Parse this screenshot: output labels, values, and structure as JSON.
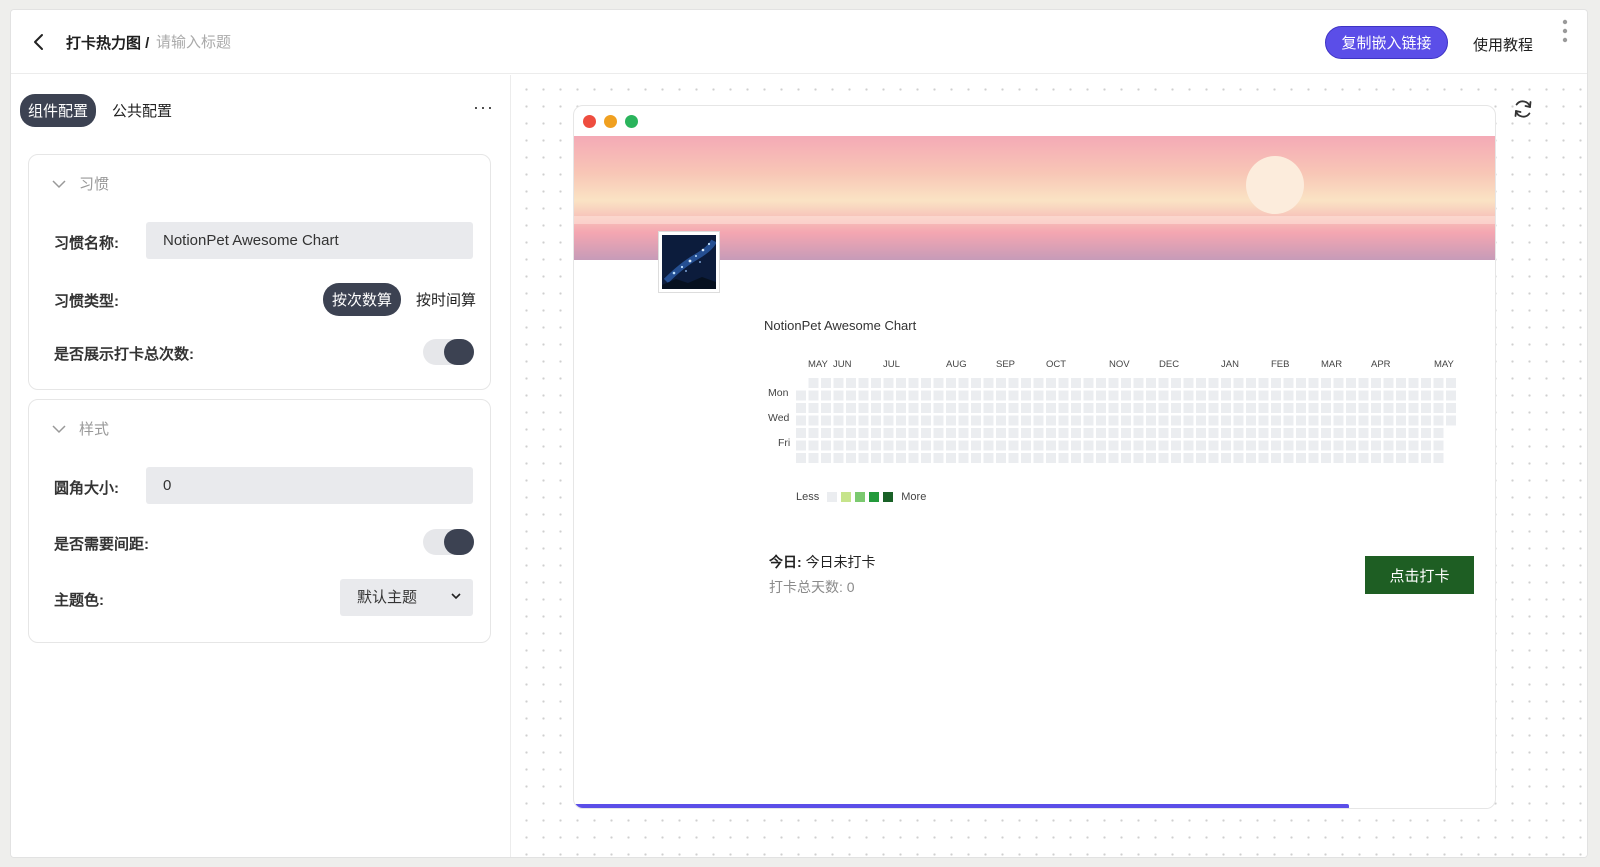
{
  "header": {
    "breadcrumb": "打卡热力图 /",
    "title_placeholder": "请输入标题",
    "copy_button": "复制嵌入链接",
    "tutorial_link": "使用教程"
  },
  "left_panel": {
    "tabs": [
      {
        "label": "组件配置",
        "active": true
      },
      {
        "label": "公共配置",
        "active": false
      }
    ],
    "more_label": "···",
    "habit_section": {
      "heading": "习惯",
      "name_label": "习惯名称:",
      "name_value": "NotionPet Awesome Chart",
      "type_label": "习惯类型:",
      "type_options": [
        "按次数算",
        "按时间算"
      ],
      "type_selected": "按次数算",
      "show_total_label": "是否展示打卡总次数:",
      "show_total": true
    },
    "style_section": {
      "heading": "样式",
      "radius_label": "圆角大小:",
      "radius_value": "0",
      "spacing_label": "是否需要间距:",
      "spacing": true,
      "theme_label": "主题色:",
      "theme_value": "默认主题"
    }
  },
  "preview": {
    "chart_title": "NotionPet Awesome Chart",
    "months": [
      "MAY",
      "JUN",
      "JUL",
      "AUG",
      "SEP",
      "OCT",
      "NOV",
      "DEC",
      "JAN",
      "FEB",
      "MAR",
      "APR",
      "MAY"
    ],
    "day_labels": [
      "Mon",
      "Wed",
      "Fri"
    ],
    "legend_less": "Less",
    "legend_more": "More",
    "legend_colors": [
      "#ebedf0",
      "#c6e48b",
      "#7bc96f",
      "#239a3b",
      "#196127"
    ],
    "today_label": "今日:",
    "today_value": "今日未打卡",
    "total_label": "打卡总天数: 0",
    "checkin_button": "点击打卡",
    "progress_fraction": 0.84,
    "traffic_colors": [
      "#ee4d3f",
      "#f0a020",
      "#2ab45c"
    ]
  }
}
